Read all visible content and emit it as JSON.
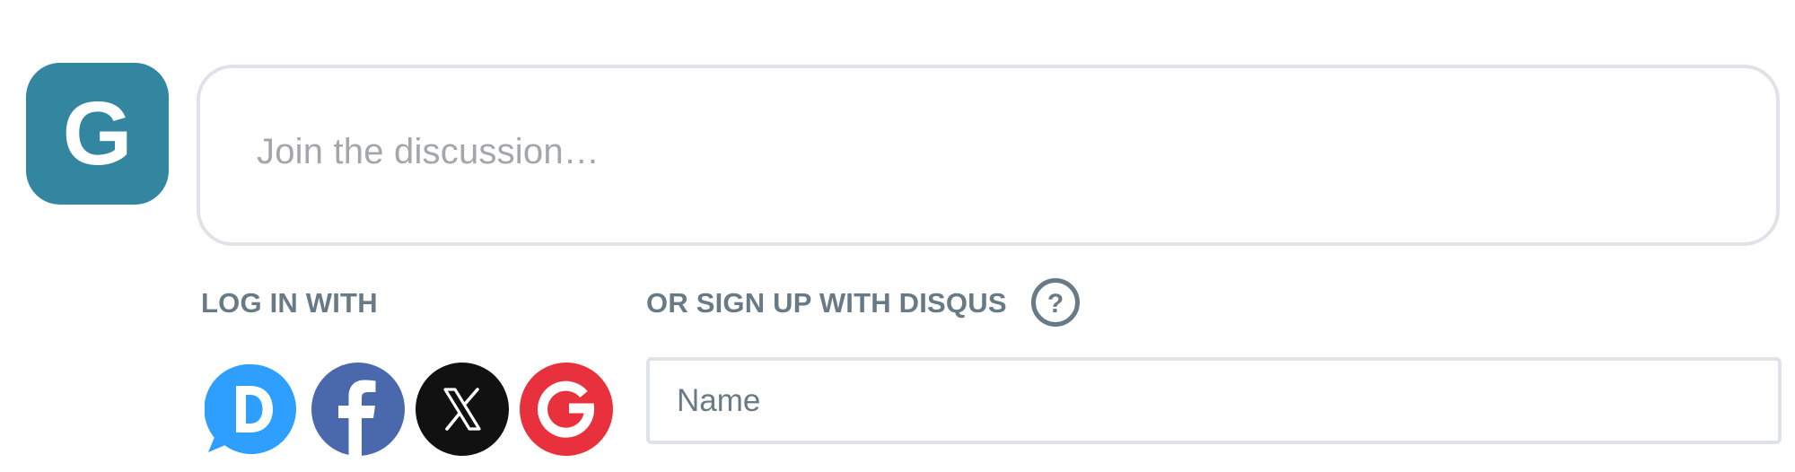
{
  "avatar": {
    "initial": "G",
    "color": "#3286a0"
  },
  "comment": {
    "placeholder": "Join the discussion…"
  },
  "login": {
    "label": "LOG IN WITH",
    "providers": [
      {
        "name": "Disqus",
        "icon": "disqus-icon",
        "color": "#2e9fff",
        "glyph": "D"
      },
      {
        "name": "Facebook",
        "icon": "facebook-icon",
        "color": "#4a69ad",
        "glyph": "f"
      },
      {
        "name": "X",
        "icon": "x-icon",
        "color": "#111111",
        "glyph": "X"
      },
      {
        "name": "Google",
        "icon": "google-icon",
        "color": "#e8313d",
        "glyph": "G"
      }
    ]
  },
  "signup": {
    "label": "OR SIGN UP WITH DISQUS",
    "help_icon": "question-mark-icon",
    "help_glyph": "?",
    "name_placeholder": "Name"
  },
  "colors": {
    "label_text": "#687a86",
    "border": "#dfe3e9",
    "placeholder": "#a3a7ab"
  }
}
